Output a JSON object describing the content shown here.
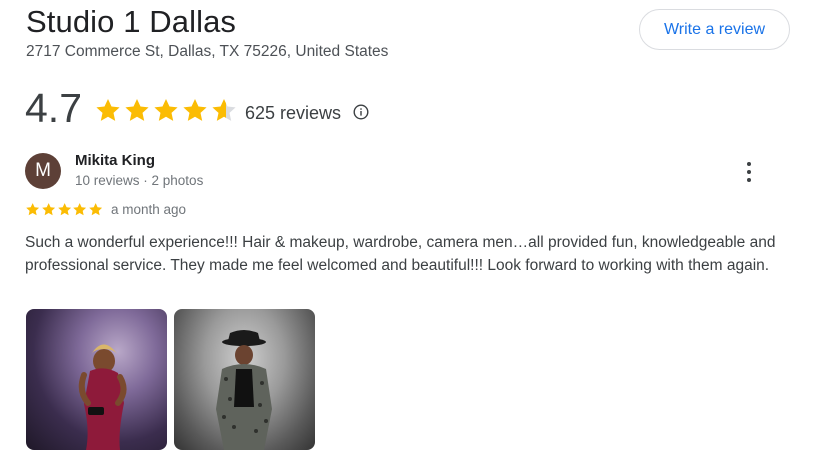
{
  "place": {
    "title": "Studio 1 Dallas",
    "address": "2717 Commerce St, Dallas, TX 75226, United States",
    "write_review_label": "Write a review",
    "rating": "4.7",
    "rating_value": 4.7,
    "reviews_count": "625 reviews",
    "star_color": "#fbbc04",
    "empty_star_color": "#dadce0"
  },
  "review": {
    "avatar_letter": "M",
    "avatar_color": "#5d4037",
    "name": "Mikita King",
    "meta": "10 reviews · 2 photos",
    "stars": 5,
    "time_ago": "a month ago",
    "text": "Such a wonderful experience!!! Hair & makeup, wardrobe, camera men…all provided fun, knowledgeable and professional service. They made me feel welcomed and beautiful!!! Look forward to working with them again."
  },
  "icons": {
    "info": "info-icon",
    "more": "more-vert-icon",
    "star": "star-icon"
  }
}
